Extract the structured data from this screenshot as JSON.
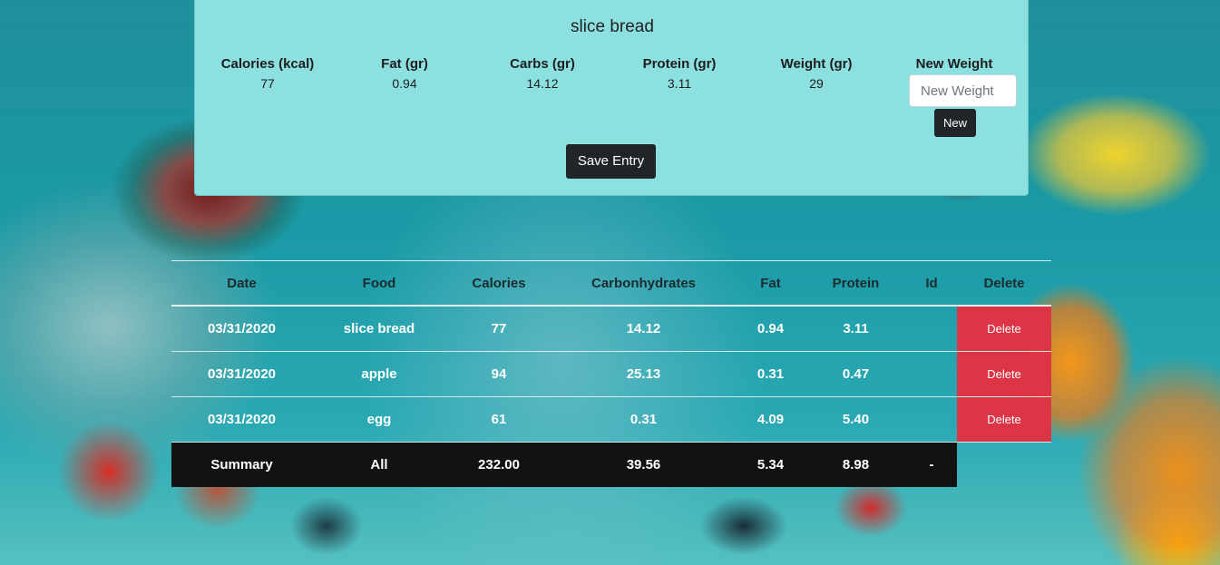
{
  "colors": {
    "card_bg": "#8de0e0",
    "dark_button": "#212529",
    "delete_button": "#dc3545",
    "summary_bg": "#121212"
  },
  "entry": {
    "food_name": "slice bread",
    "nutrients": [
      {
        "label": "Calories (kcal)",
        "value": "77"
      },
      {
        "label": "Fat (gr)",
        "value": "0.94"
      },
      {
        "label": "Carbs (gr)",
        "value": "14.12"
      },
      {
        "label": "Protein (gr)",
        "value": "3.11"
      },
      {
        "label": "Weight (gr)",
        "value": "29"
      }
    ],
    "new_weight_label": "New Weight",
    "new_weight_placeholder": "New Weight",
    "new_button": "New",
    "save_button": "Save Entry"
  },
  "table": {
    "headers": [
      "Date",
      "Food",
      "Calories",
      "Carbonhydrates",
      "Fat",
      "Protein",
      "Id",
      "Delete"
    ],
    "rows": [
      {
        "date": "03/31/2020",
        "food": "slice bread",
        "calories": "77",
        "carbs": "14.12",
        "fat": "0.94",
        "protein": "3.11",
        "id": "",
        "delete": "Delete"
      },
      {
        "date": "03/31/2020",
        "food": "apple",
        "calories": "94",
        "carbs": "25.13",
        "fat": "0.31",
        "protein": "0.47",
        "id": "",
        "delete": "Delete"
      },
      {
        "date": "03/31/2020",
        "food": "egg",
        "calories": "61",
        "carbs": "0.31",
        "fat": "4.09",
        "protein": "5.40",
        "id": "",
        "delete": "Delete"
      }
    ],
    "summary": {
      "label": "Summary",
      "food": "All",
      "calories": "232.00",
      "carbs": "39.56",
      "fat": "5.34",
      "protein": "8.98",
      "id": "-"
    }
  }
}
